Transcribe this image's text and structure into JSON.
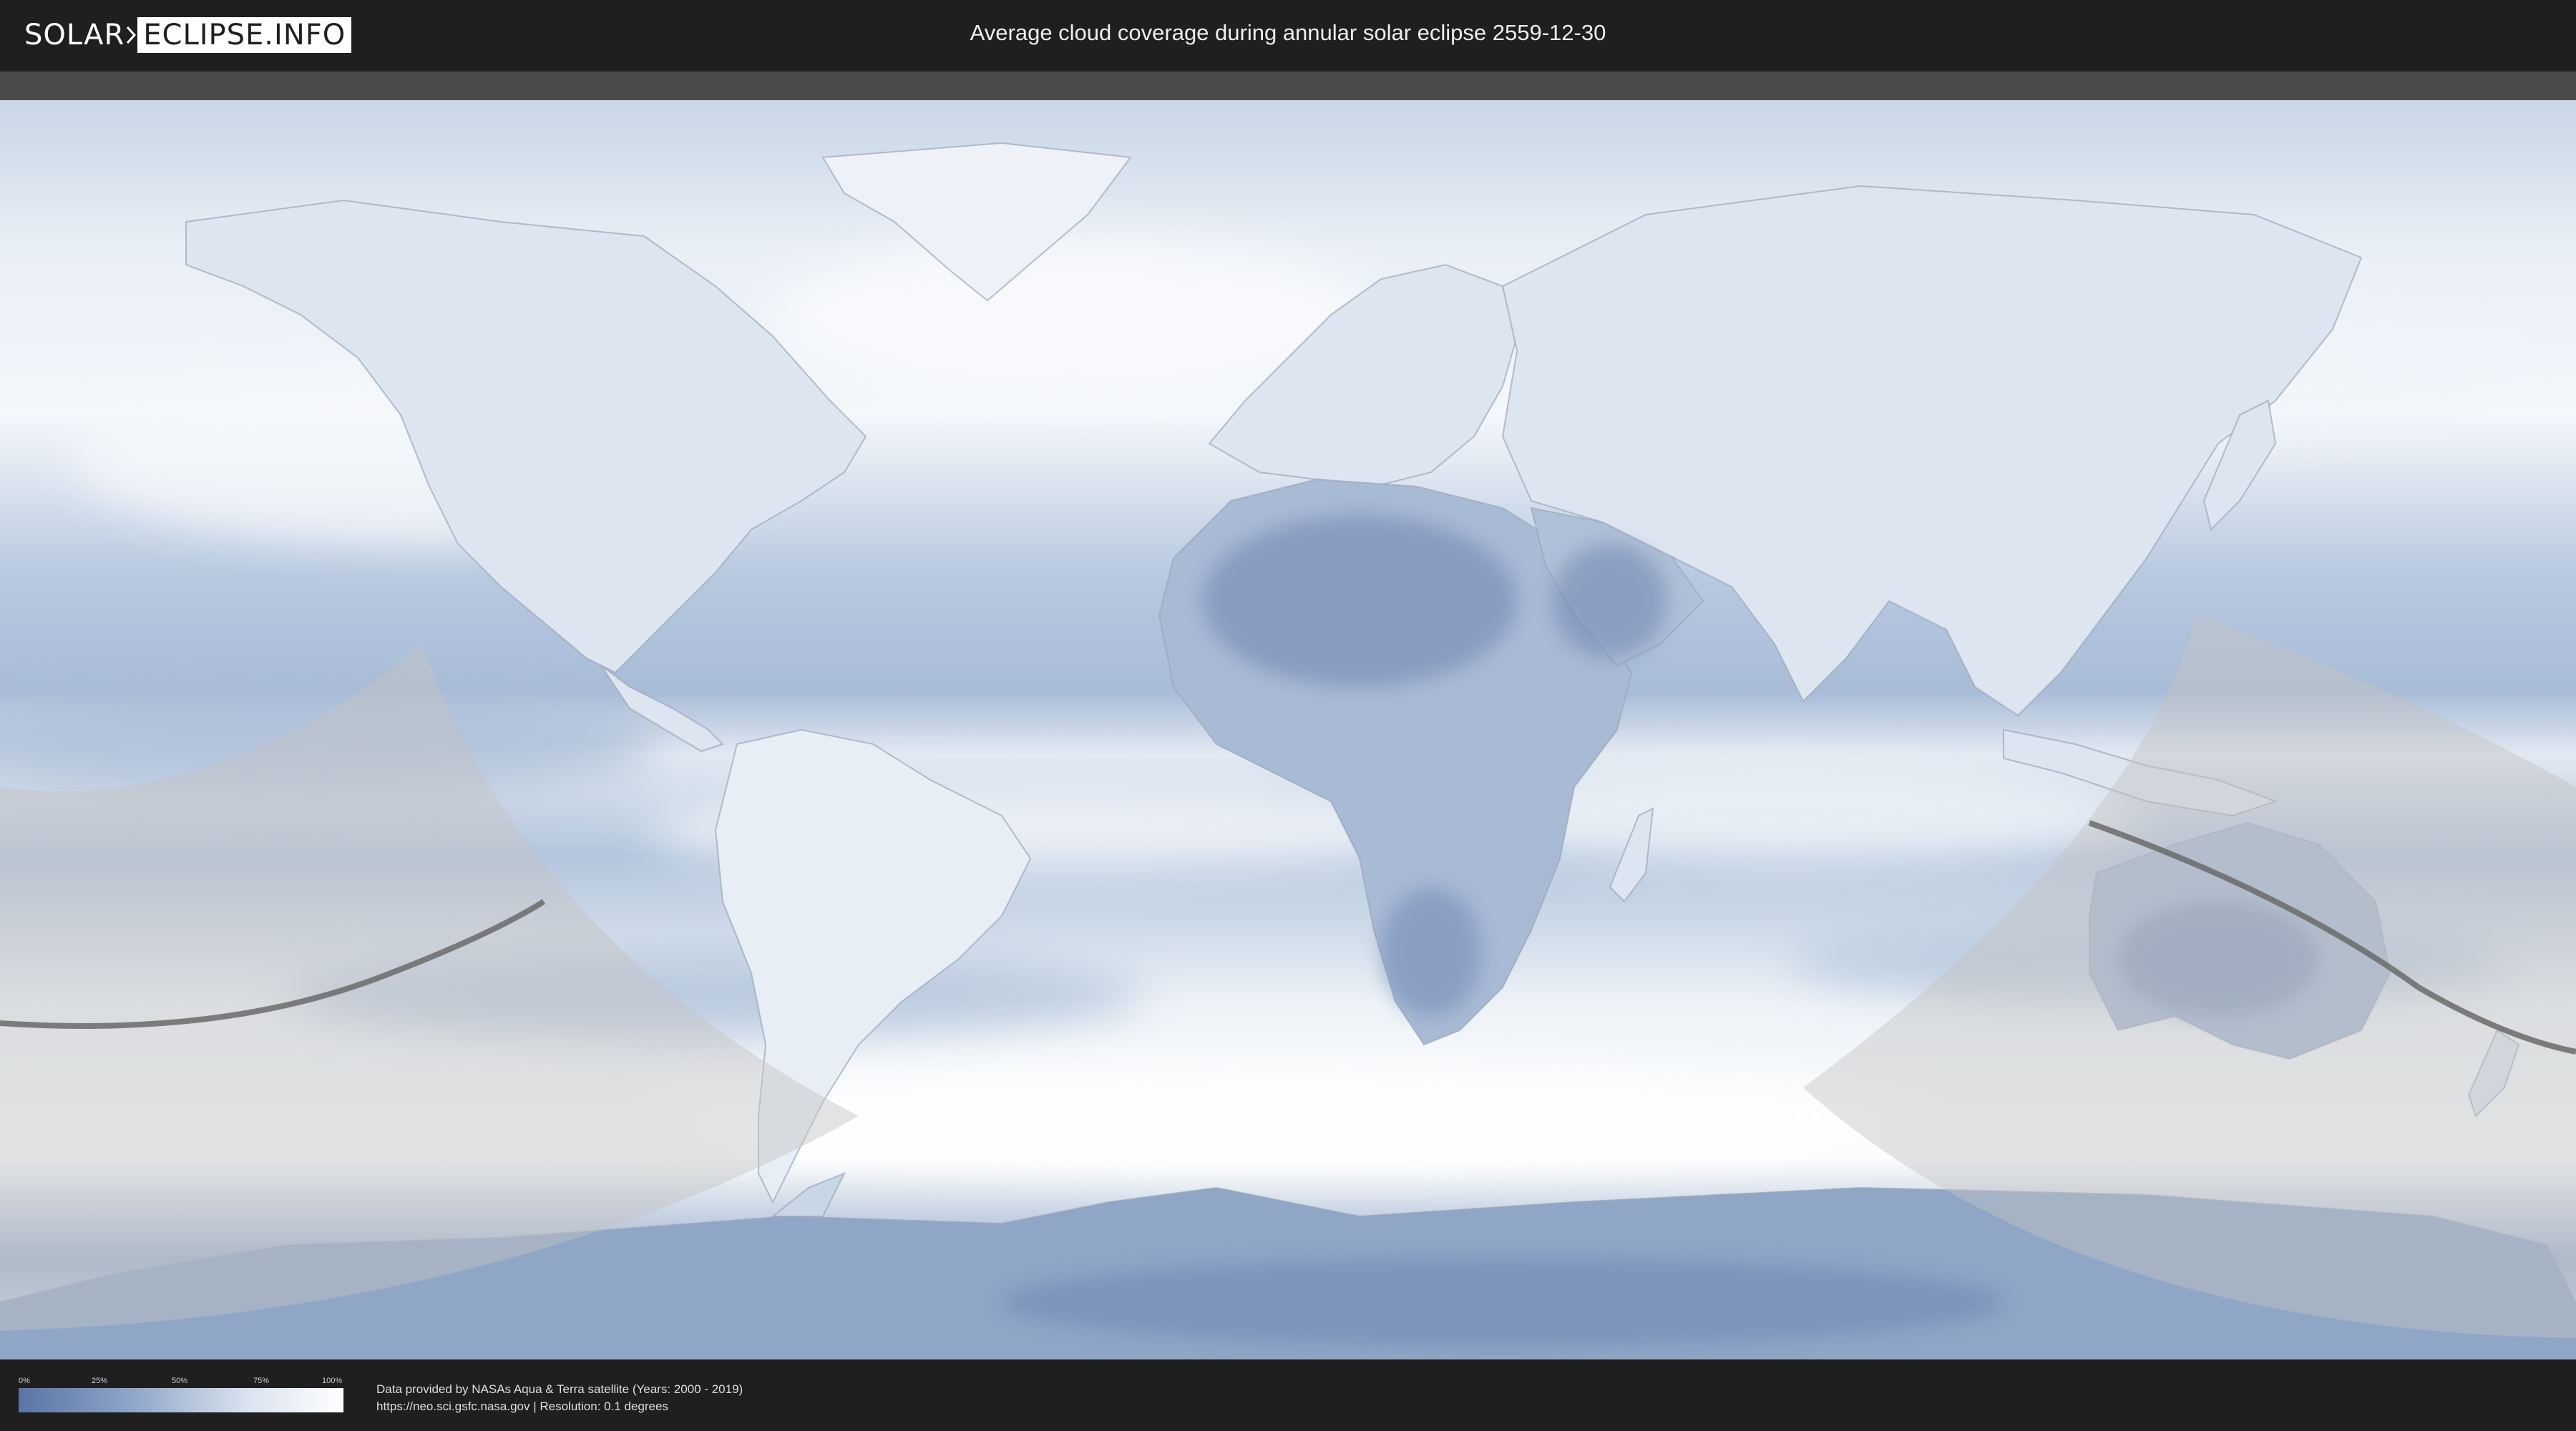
{
  "header": {
    "logo_solar": "SOLAR",
    "logo_eclipse": "ECLIPSE.INFO",
    "title": "Average cloud coverage during annular solar eclipse 2559-12-30"
  },
  "map": {
    "kind": "world-equirectangular",
    "layer": "cloud-coverage",
    "overlays": [
      "eclipse-visibility-zone-west",
      "eclipse-visibility-zone-east",
      "annular-path-west",
      "annular-path-east"
    ],
    "colors": {
      "clear": "#5a74a4",
      "cloudy": "#ffffff",
      "visibility_zone": "#c4c4c4",
      "path": "#6a6a6a"
    }
  },
  "legend": {
    "ticks": [
      "0%",
      "25%",
      "50%",
      "75%",
      "100%"
    ],
    "colors": [
      "#5a74a4",
      "#ffffff"
    ]
  },
  "footer": {
    "credit_line1": "Data provided by NASAs Aqua & Terra satellite (Years: 2000 - 2019)",
    "credit_line2": "https://neo.sci.gsfc.nasa.gov | Resolution: 0.1 degrees"
  }
}
